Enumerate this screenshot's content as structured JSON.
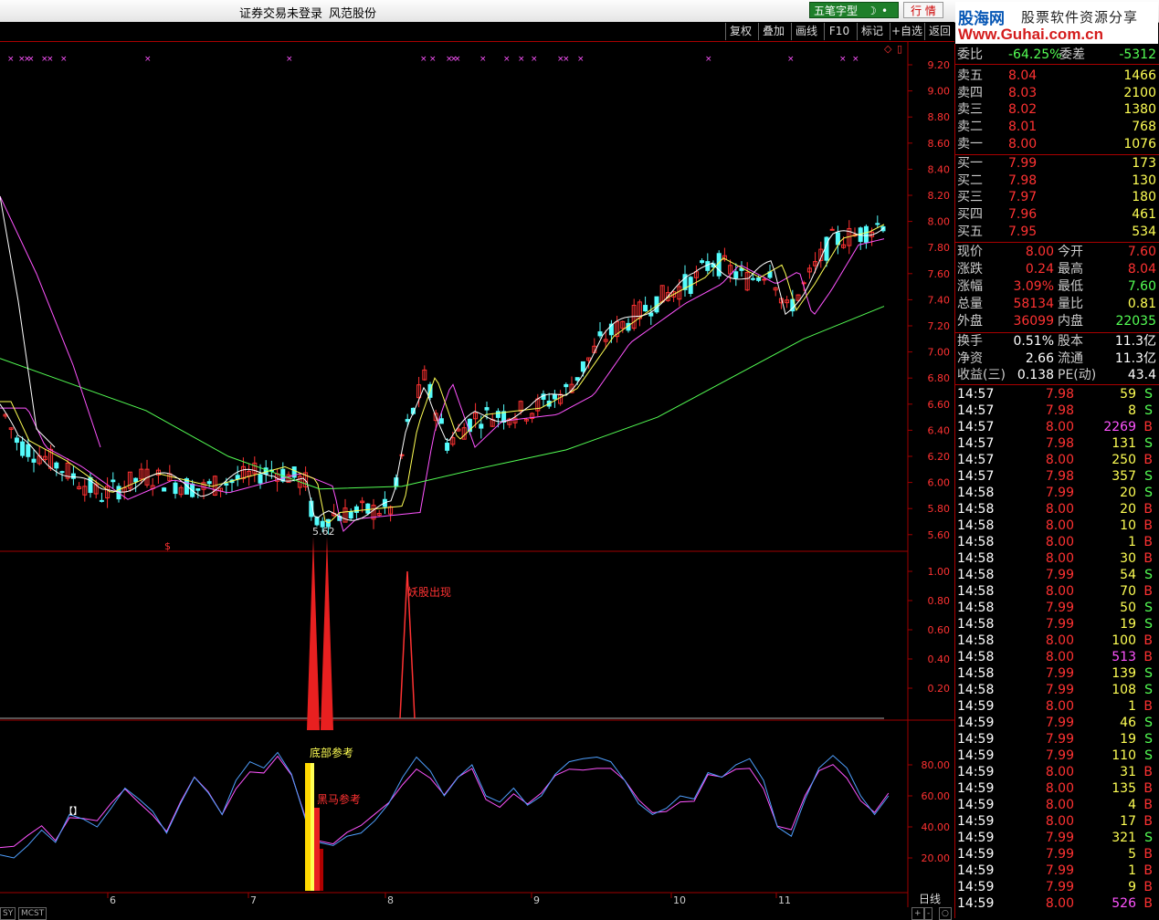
{
  "window": {
    "title_login": "证券交易未登录",
    "title_broker": "风范股份"
  },
  "ime": {
    "mode_label": "五笔字型",
    "market_button": "行 情"
  },
  "logo": {
    "brand": "股海网",
    "tagline": "股票软件资源分享",
    "url": "Www.Guhai.com.cn"
  },
  "toolbar": [
    "复权",
    "叠加",
    "画线",
    "F10",
    "标记",
    "+自选",
    "返回"
  ],
  "colors": {
    "up": "#ff3232",
    "down": "#54fcfc",
    "ma5": "#ffffff",
    "ma10": "#ffff54",
    "ma20": "#ff54ff",
    "ma60": "#54ff54",
    "grid": "#a00000"
  },
  "main_panel": {
    "price_axis": [
      "9.20",
      "9.00",
      "8.80",
      "8.60",
      "8.40",
      "8.20",
      "8.00",
      "7.80",
      "7.60",
      "7.40",
      "7.20",
      "7.00",
      "6.80",
      "6.60",
      "6.40",
      "6.20",
      "6.00",
      "5.80",
      "5.60"
    ],
    "low_label": "5.62",
    "signal_mark": "$"
  },
  "indicator_panel": {
    "axis": [
      "1.00",
      "0.80",
      "0.60",
      "0.40",
      "0.20"
    ],
    "signal_label": "妖股出现"
  },
  "kd_panel": {
    "axis": [
      "80.00",
      "60.00",
      "40.00",
      "20.00"
    ],
    "label_bottom": "底部参考",
    "label_horse": "黑马参考",
    "bracket_icon": "【】"
  },
  "date_axis": [
    "6",
    "7",
    "8",
    "9",
    "10",
    "11"
  ],
  "period_label": "日线",
  "bottom_tabs": [
    "SY",
    "MCST"
  ],
  "quote": {
    "weibi": {
      "label": "委比",
      "value": "-64.25%",
      "label2": "委差",
      "value2": "-5312"
    },
    "asks": [
      {
        "label": "卖五",
        "price": "8.04",
        "vol": "1466"
      },
      {
        "label": "卖四",
        "price": "8.03",
        "vol": "2100"
      },
      {
        "label": "卖三",
        "price": "8.02",
        "vol": "1380"
      },
      {
        "label": "卖二",
        "price": "8.01",
        "vol": "768"
      },
      {
        "label": "卖一",
        "price": "8.00",
        "vol": "1076"
      }
    ],
    "bids": [
      {
        "label": "买一",
        "price": "7.99",
        "vol": "173"
      },
      {
        "label": "买二",
        "price": "7.98",
        "vol": "130"
      },
      {
        "label": "买三",
        "price": "7.97",
        "vol": "180"
      },
      {
        "label": "买四",
        "price": "7.96",
        "vol": "461"
      },
      {
        "label": "买五",
        "price": "7.95",
        "vol": "534"
      }
    ],
    "stats": [
      {
        "l1": "现价",
        "v1": "8.00",
        "l2": "今开",
        "v2": "7.60"
      },
      {
        "l1": "涨跌",
        "v1": "0.24",
        "l2": "最高",
        "v2": "8.04"
      },
      {
        "l1": "涨幅",
        "v1": "3.09%",
        "l2": "最低",
        "v2": "7.60"
      },
      {
        "l1": "总量",
        "v1": "58134",
        "l2": "量比",
        "v2": "0.81"
      },
      {
        "l1": "外盘",
        "v1": "36099",
        "l2": "内盘",
        "v2": "22035"
      }
    ],
    "stats2": [
      {
        "l1": "换手",
        "v1": "0.51%",
        "l2": "股本",
        "v2": "11.3亿"
      },
      {
        "l1": "净资",
        "v1": "2.66",
        "l2": "流通",
        "v2": "11.3亿"
      },
      {
        "l1": "收益(三)",
        "v1": "0.138",
        "l2": "PE(动)",
        "v2": "43.4"
      }
    ],
    "ticks": [
      [
        "14:57",
        "7.98",
        "59",
        "S"
      ],
      [
        "14:57",
        "7.98",
        "8",
        "S"
      ],
      [
        "14:57",
        "8.00",
        "2269",
        "B"
      ],
      [
        "14:57",
        "7.98",
        "131",
        "S"
      ],
      [
        "14:57",
        "8.00",
        "250",
        "B"
      ],
      [
        "14:57",
        "7.98",
        "357",
        "S"
      ],
      [
        "14:58",
        "7.99",
        "20",
        "S"
      ],
      [
        "14:58",
        "8.00",
        "20",
        "B"
      ],
      [
        "14:58",
        "8.00",
        "10",
        "B"
      ],
      [
        "14:58",
        "8.00",
        "1",
        "B"
      ],
      [
        "14:58",
        "8.00",
        "30",
        "B"
      ],
      [
        "14:58",
        "7.99",
        "54",
        "S"
      ],
      [
        "14:58",
        "8.00",
        "70",
        "B"
      ],
      [
        "14:58",
        "7.99",
        "50",
        "S"
      ],
      [
        "14:58",
        "7.99",
        "19",
        "S"
      ],
      [
        "14:58",
        "8.00",
        "100",
        "B"
      ],
      [
        "14:58",
        "8.00",
        "513",
        "B"
      ],
      [
        "14:58",
        "7.99",
        "139",
        "S"
      ],
      [
        "14:58",
        "7.99",
        "108",
        "S"
      ],
      [
        "14:59",
        "8.00",
        "1",
        "B"
      ],
      [
        "14:59",
        "7.99",
        "46",
        "S"
      ],
      [
        "14:59",
        "7.99",
        "19",
        "S"
      ],
      [
        "14:59",
        "7.99",
        "110",
        "S"
      ],
      [
        "14:59",
        "8.00",
        "31",
        "B"
      ],
      [
        "14:59",
        "8.00",
        "135",
        "B"
      ],
      [
        "14:59",
        "8.00",
        "4",
        "B"
      ],
      [
        "14:59",
        "8.00",
        "17",
        "B"
      ],
      [
        "14:59",
        "7.99",
        "321",
        "S"
      ],
      [
        "14:59",
        "7.99",
        "5",
        "B"
      ],
      [
        "14:59",
        "7.99",
        "1",
        "B"
      ],
      [
        "14:59",
        "7.99",
        "9",
        "B"
      ],
      [
        "14:59",
        "8.00",
        "526",
        "B"
      ]
    ]
  }
}
